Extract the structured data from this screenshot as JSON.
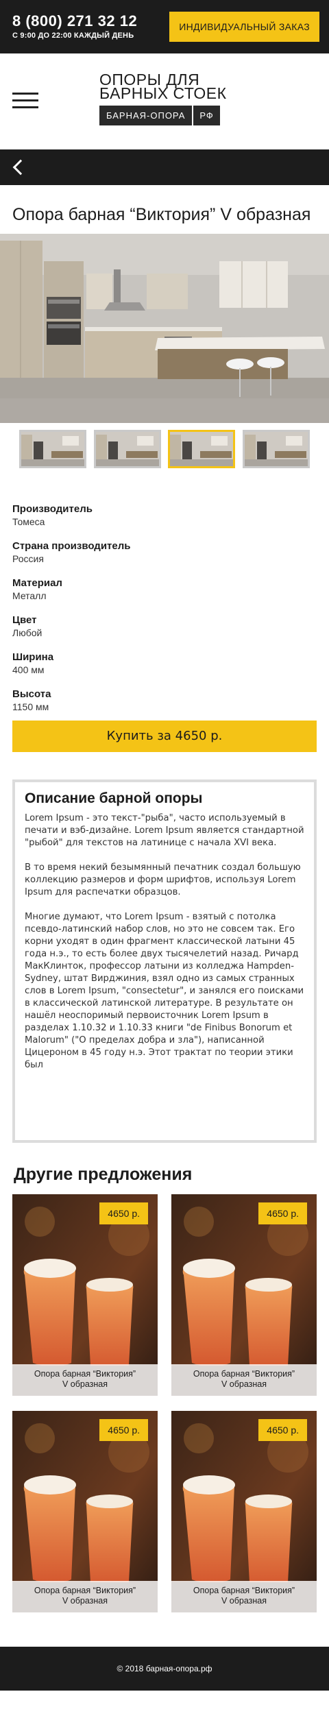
{
  "topbar": {
    "phone": "8 (800) 271 32 12",
    "hours": "С 9:00 ДО 22:00 КАЖДЫЙ ДЕНЬ",
    "order_label": "ИНДИВИДУАЛЬНЫЙ ЗАКАЗ"
  },
  "logo": {
    "line1": "ОПОРЫ ДЛЯ",
    "line2": "БАРНЫХ СТОЕК",
    "badge_main": "БАРНАЯ-ОПОРА",
    "badge_tld": "РФ"
  },
  "product": {
    "title": "Опора барная “Виктория” V образная",
    "buy_label": "Купить за 4650 р."
  },
  "specs": [
    {
      "label": "Производитель",
      "value": "Томеса"
    },
    {
      "label": "Страна производитель",
      "value": "Россия"
    },
    {
      "label": "Материал",
      "value": "Металл"
    },
    {
      "label": "Цвет",
      "value": "Любой"
    },
    {
      "label": "Ширина",
      "value": "400 мм"
    },
    {
      "label": "Высота",
      "value": "1150 мм"
    }
  ],
  "description": {
    "title": "Описание барной опоры",
    "paragraphs": [
      "Lorem Ipsum - это текст-\"рыба\", часто используемый в печати и вэб-дизайне. Lorem Ipsum является стандартной \"рыбой\" для текстов на латинице с начала XVI века.",
      "В то время некий безымянный печатник создал большую коллекцию размеров и форм шрифтов, используя Lorem Ipsum для распечатки образцов.",
      "Многие думают, что Lorem Ipsum - взятый с потолка псевдо-латинский набор слов, но это не совсем так. Его корни уходят в один фрагмент классической латыни 45 года н.э., то есть более двух тысячелетий назад. Ричард МакКлинток, профессор латыни из колледжа Hampden-Sydney, штат Вирджиния, взял одно из самых странных слов в Lorem Ipsum, \"consectetur\", и занялся его поисками в классической латинской литературе. В результате он нашёл неоспоримый первоисточник Lorem Ipsum в разделах 1.10.32 и 1.10.33 книги \"de Finibus Bonorum et Malorum\" (\"О пределах добра и зла\"), написанной Цицероном в 45 году н.э. Этот трактат по теории этики был"
    ]
  },
  "other": {
    "title": "Другие предложения",
    "items": [
      {
        "price": "4650 р.",
        "name_line1": "Опора барная “Виктория”",
        "name_line2": "V образная"
      },
      {
        "price": "4650 р.",
        "name_line1": "Опора барная “Виктория”",
        "name_line2": "V образная"
      },
      {
        "price": "4650 р.",
        "name_line1": "Опора барная “Виктория”",
        "name_line2": "V образная"
      },
      {
        "price": "4650 р.",
        "name_line1": "Опора барная “Виктория”",
        "name_line2": "V образная"
      }
    ]
  },
  "footer": {
    "copyright": "© 2018 барная-опора.рф"
  },
  "colors": {
    "accent": "#f4c316",
    "dark": "#1c1c1c"
  },
  "thumbnails": {
    "count": 4,
    "active_index": 2
  }
}
